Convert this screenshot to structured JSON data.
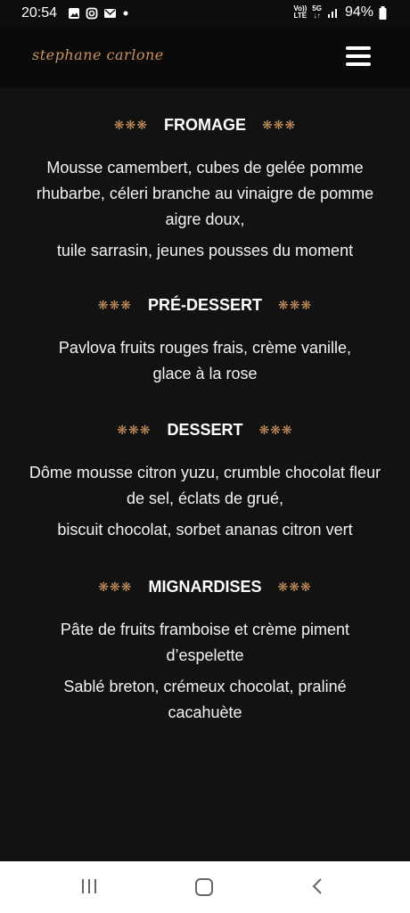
{
  "status_bar": {
    "time": "20:54",
    "network_top": "Vo))",
    "network_bottom": "LTE",
    "signal_label": "5G",
    "battery": "94%"
  },
  "header": {
    "logo": "stephane carlone",
    "menu_icon": "hamburger-menu-icon"
  },
  "menu": [
    {
      "title": "FROMAGE",
      "stars": "❋❋❋",
      "paragraphs": [
        "Mousse camembert, cubes de gelée pomme rhubarbe, céleri branche au vinaigre de pomme aigre doux,",
        "tuile sarrasin, jeunes pousses du moment"
      ]
    },
    {
      "title": "PRÉ-DESSERT",
      "stars": "❋❋❋",
      "paragraphs": [
        "Pavlova fruits rouges frais, crème vanille, glace à la rose"
      ]
    },
    {
      "title": "DESSERT",
      "stars": "❋❋❋",
      "paragraphs": [
        "Dôme mousse citron yuzu, crumble chocolat fleur de sel, éclats de grué,",
        "biscuit chocolat, sorbet ananas citron vert"
      ]
    },
    {
      "title": "MIGNARDISES",
      "stars": "❋❋❋",
      "paragraphs": [
        "Pâte de fruits framboise et crème piment d’espelette",
        "Sablé breton, crémeux chocolat, praliné cacahuète"
      ]
    }
  ],
  "colors": {
    "background": "#121212",
    "accent": "#c8925c",
    "text": "#ffffff"
  }
}
